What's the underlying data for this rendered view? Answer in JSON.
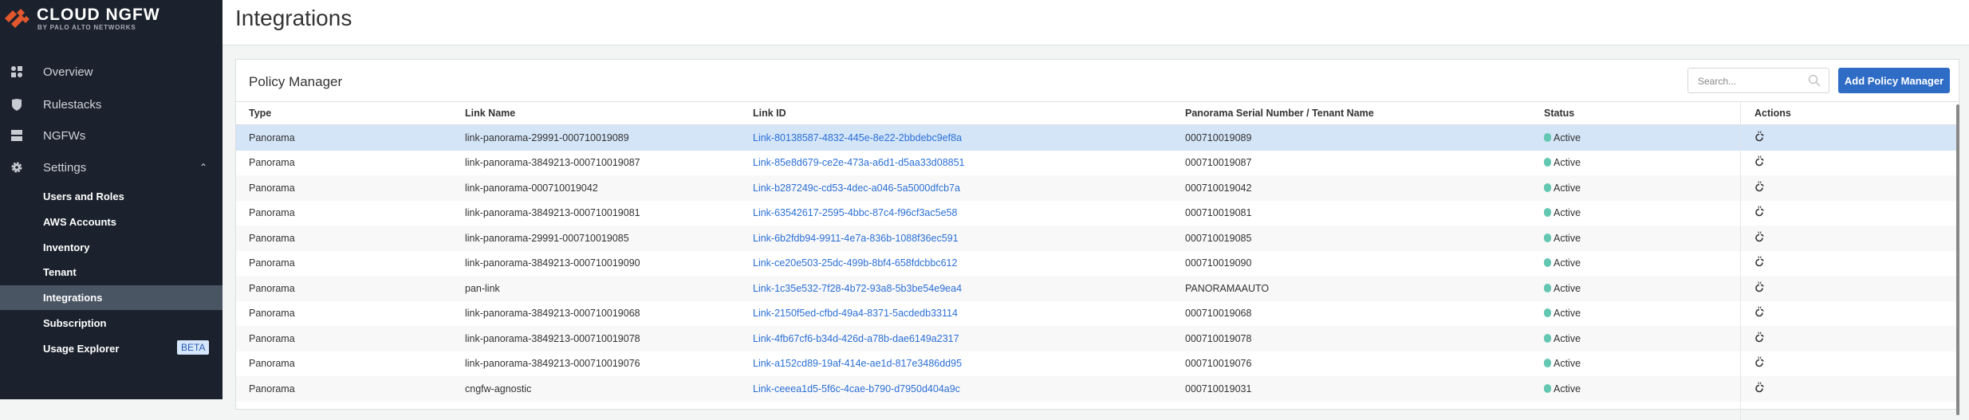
{
  "brand": {
    "name": "CLOUD NGFW",
    "sub": "BY PALO ALTO NETWORKS",
    "accent": "#e2572d"
  },
  "sidebar": {
    "items": [
      {
        "label": "Overview",
        "icon": "dashboard-icon"
      },
      {
        "label": "Rulestacks",
        "icon": "shield-icon"
      },
      {
        "label": "NGFWs",
        "icon": "server-icon"
      },
      {
        "label": "Settings",
        "icon": "gear-icon"
      }
    ],
    "settings_sub": [
      {
        "label": "Users and Roles"
      },
      {
        "label": "AWS Accounts"
      },
      {
        "label": "Inventory"
      },
      {
        "label": "Tenant"
      },
      {
        "label": "Integrations",
        "active": true
      },
      {
        "label": "Subscription"
      },
      {
        "label": "Usage Explorer",
        "badge": "BETA"
      }
    ]
  },
  "header": {
    "title": "Integrations"
  },
  "card": {
    "title": "Policy Manager",
    "search_placeholder": "Search...",
    "add_button": "Add Policy Manager"
  },
  "table": {
    "columns": [
      "Type",
      "Link Name",
      "Link ID",
      "Panorama Serial Number / Tenant Name",
      "Status",
      "Actions"
    ],
    "rows": [
      [
        "Panorama",
        "link-panorama-29991-000710019089",
        "Link-80138587-4832-445e-8e22-2bbdebc9ef8a",
        "000710019089",
        "Active"
      ],
      [
        "Panorama",
        "link-panorama-3849213-000710019087",
        "Link-85e8d679-ce2e-473a-a6d1-d5aa33d08851",
        "000710019087",
        "Active"
      ],
      [
        "Panorama",
        "link-panorama-000710019042",
        "Link-b287249c-cd53-4dec-a046-5a5000dfcb7a",
        "000710019042",
        "Active"
      ],
      [
        "Panorama",
        "link-panorama-3849213-000710019081",
        "Link-63542617-2595-4bbc-87c4-f96cf3ac5e58",
        "000710019081",
        "Active"
      ],
      [
        "Panorama",
        "link-panorama-29991-000710019085",
        "Link-6b2fdb94-9911-4e7a-836b-1088f36ec591",
        "000710019085",
        "Active"
      ],
      [
        "Panorama",
        "link-panorama-3849213-000710019090",
        "Link-ce20e503-25dc-499b-8bf4-658fdcbbc612",
        "000710019090",
        "Active"
      ],
      [
        "Panorama",
        "pan-link",
        "Link-1c35e532-7f28-4b72-93a8-5b3be54e9ea4",
        "PANORAMAAUTO",
        "Active"
      ],
      [
        "Panorama",
        "link-panorama-3849213-000710019068",
        "Link-2150f5ed-cfbd-49a4-8371-5acdedb33114",
        "000710019068",
        "Active"
      ],
      [
        "Panorama",
        "link-panorama-3849213-000710019078",
        "Link-4fb67cf6-b34d-426d-a78b-dae6149a2317",
        "000710019078",
        "Active"
      ],
      [
        "Panorama",
        "link-panorama-3849213-000710019076",
        "Link-a152cd89-19af-414e-ae1d-817e3486dd95",
        "000710019076",
        "Active"
      ],
      [
        "Panorama",
        "cngfw-agnostic",
        "Link-ceeea1d5-5f6c-4cae-b790-d7950d404a9c",
        "000710019031",
        "Active"
      ]
    ]
  }
}
